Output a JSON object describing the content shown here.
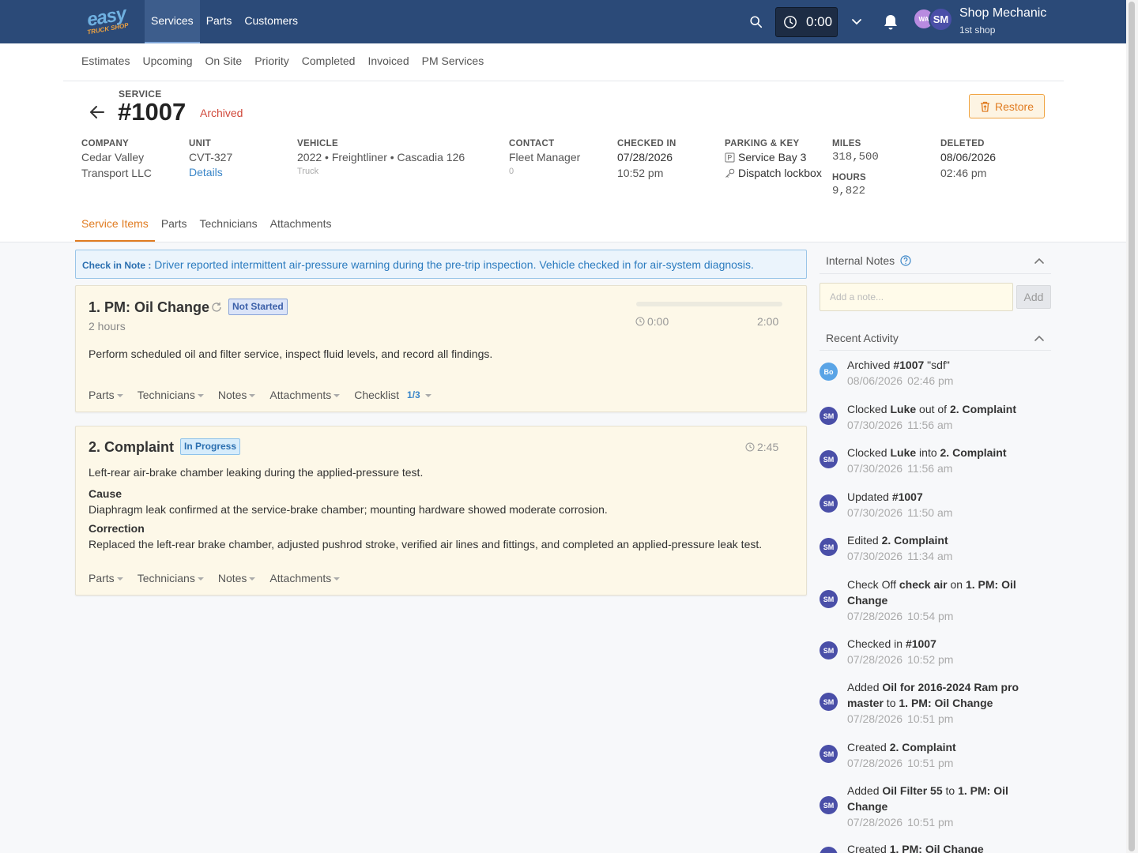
{
  "topbar": {
    "logo": {
      "line1": "easy",
      "line2": "TRUCK SHOP"
    },
    "nav": [
      {
        "label": "Services",
        "active": true
      },
      {
        "label": "Parts",
        "active": false
      },
      {
        "label": "Customers",
        "active": false
      }
    ],
    "timer": "0:00",
    "avatars": [
      "WA",
      "SM"
    ],
    "user": {
      "name": "Shop Mechanic",
      "shop": "1st shop"
    }
  },
  "subnav": [
    "Estimates",
    "Upcoming",
    "On Site",
    "Priority",
    "Completed",
    "Invoiced",
    "PM Services"
  ],
  "service": {
    "label": "SERVICE",
    "number": "#1007",
    "status": "Archived",
    "restore_label": "Restore",
    "company": {
      "label": "COMPANY",
      "line1": "Cedar Valley",
      "line2": "Transport LLC"
    },
    "unit": {
      "label": "UNIT",
      "value": "CVT-327",
      "link": "Details"
    },
    "vehicle": {
      "label": "VEHICLE",
      "value": "2022 • Freightliner • Cascadia 126",
      "type": "Truck"
    },
    "contact": {
      "label": "CONTACT",
      "value": "Fleet Manager",
      "sub": "0"
    },
    "checked_in": {
      "label": "CHECKED IN",
      "date": "07/28/2026",
      "time": "10:52 pm"
    },
    "parking": {
      "label": "PARKING & KEY",
      "parking": "Service Bay 3",
      "key": "Dispatch lockbox"
    },
    "miles": {
      "label": "MILES",
      "value": "318,500"
    },
    "hours": {
      "label": "HOURS",
      "value": "9,822"
    },
    "deleted": {
      "label": "DELETED",
      "date": "08/06/2026",
      "time": "02:46 pm"
    }
  },
  "tabs": [
    {
      "label": "Service Items",
      "active": true
    },
    {
      "label": "Parts",
      "active": false
    },
    {
      "label": "Technicians",
      "active": false
    },
    {
      "label": "Attachments",
      "active": false
    }
  ],
  "checkin_note": {
    "label": "Check in Note :",
    "text": "Driver reported intermittent air-pressure warning during the pre-trip inspection. Vehicle checked in for air-system diagnosis."
  },
  "items": [
    {
      "title": "1. PM: Oil Change",
      "status": "Not Started",
      "duration": "2 hours",
      "description": "Perform scheduled oil and filter service, inspect fluid levels, and record all findings.",
      "time_logged": "0:00",
      "time_estimate": "2:00",
      "progress": 0,
      "footer": [
        "Parts",
        "Technicians",
        "Notes",
        "Attachments",
        "Checklist"
      ],
      "checklist_count": "1/3"
    },
    {
      "title": "2. Complaint",
      "status": "In Progress",
      "description": "Left-rear air-brake chamber leaking during the applied-pressure test.",
      "cause_label": "Cause",
      "cause": "Diaphragm leak confirmed at the service-brake chamber; mounting hardware showed moderate corrosion.",
      "correction_label": "Correction",
      "correction": "Replaced the left-rear brake chamber, adjusted pushrod stroke, verified air lines and fittings, and completed an applied-pressure leak test.",
      "time_logged": "2:45",
      "footer": [
        "Parts",
        "Technicians",
        "Notes",
        "Attachments"
      ]
    }
  ],
  "internal_notes": {
    "title": "Internal Notes",
    "placeholder": "Add a note...",
    "add_label": "Add"
  },
  "recent_activity": {
    "title": "Recent Activity",
    "entries": [
      {
        "avatar": "Bo",
        "pre": "Archived ",
        "b1": "#1007",
        "mid": " \"sdf\"",
        "b2": "",
        "post": "",
        "date": "08/06/2026",
        "time": "02:46 pm"
      },
      {
        "avatar": "SM",
        "pre": "Clocked ",
        "b1": "Luke",
        "mid": " out of ",
        "b2": "2. Complaint",
        "post": "",
        "date": "07/30/2026",
        "time": "11:56 am"
      },
      {
        "avatar": "SM",
        "pre": "Clocked ",
        "b1": "Luke",
        "mid": " into ",
        "b2": "2. Complaint",
        "post": "",
        "date": "07/30/2026",
        "time": "11:56 am"
      },
      {
        "avatar": "SM",
        "pre": "Updated ",
        "b1": "#1007",
        "mid": "",
        "b2": "",
        "post": "",
        "date": "07/30/2026",
        "time": "11:50 am"
      },
      {
        "avatar": "SM",
        "pre": "Edited ",
        "b1": "2. Complaint",
        "mid": "",
        "b2": "",
        "post": "",
        "date": "07/30/2026",
        "time": "11:34 am"
      },
      {
        "avatar": "SM",
        "pre": "Check Off ",
        "b1": "check air",
        "mid": " on ",
        "b2": "1. PM: Oil Change",
        "post": "",
        "date": "07/28/2026",
        "time": "10:54 pm"
      },
      {
        "avatar": "SM",
        "pre": "Checked in ",
        "b1": "#1007",
        "mid": "",
        "b2": "",
        "post": "",
        "date": "07/28/2026",
        "time": "10:52 pm"
      },
      {
        "avatar": "SM",
        "pre": "Added ",
        "b1": "Oil for 2016-2024 Ram pro master",
        "mid": " to ",
        "b2": "1. PM: Oil Change",
        "post": "",
        "date": "07/28/2026",
        "time": "10:51 pm"
      },
      {
        "avatar": "SM",
        "pre": "Created ",
        "b1": "2. Complaint",
        "mid": "",
        "b2": "",
        "post": "",
        "date": "07/28/2026",
        "time": "10:51 pm"
      },
      {
        "avatar": "SM",
        "pre": "Added ",
        "b1": "Oil Filter 55",
        "mid": " to ",
        "b2": "1. PM: Oil Change",
        "post": "",
        "date": "07/28/2026",
        "time": "10:51 pm"
      },
      {
        "avatar": "SM",
        "pre": "Created ",
        "b1": "1. PM: Oil Change",
        "mid": "",
        "b2": "",
        "post": "",
        "date": "",
        "time": ""
      }
    ]
  },
  "colors": {
    "navbar": "#2b4a78",
    "accent": "#e07b20",
    "link": "#3a86c8",
    "archived": "#d0483a",
    "card_bg": "#fdf8e8"
  }
}
